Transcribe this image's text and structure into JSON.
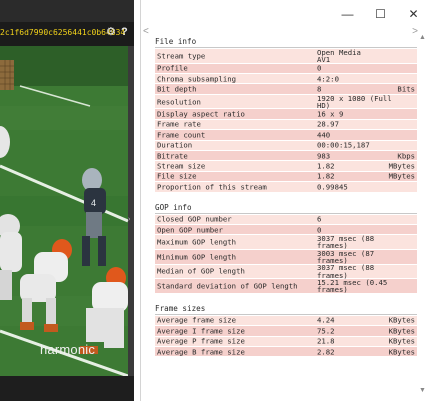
{
  "video_window": {
    "hash_text": "2c1f6d7990c6256441c0b64834",
    "gear_icon": "gear-icon",
    "help_label": "?",
    "watermark": "harmonic"
  },
  "info_window": {
    "controls": {
      "minimize": "—",
      "maximize": "☐",
      "close": "✕"
    },
    "nav": {
      "prev": "<",
      "next": ">"
    },
    "sections": [
      {
        "title": "File info",
        "rows": [
          {
            "label": "Stream type",
            "value": "Open Media\nAV1",
            "unit": ""
          },
          {
            "label": "Profile",
            "value": "0",
            "unit": ""
          },
          {
            "label": "Chroma subsampling",
            "value": "4:2:0",
            "unit": ""
          },
          {
            "label": "Bit depth",
            "value": "8",
            "unit": "Bits"
          },
          {
            "label": "Resolution",
            "value": "1920 x 1080 (Full\nHD)",
            "unit": ""
          },
          {
            "label": "Display aspect ratio",
            "value": "16 x 9",
            "unit": ""
          },
          {
            "label": "Frame rate",
            "value": "28.97",
            "unit": ""
          },
          {
            "label": "Frame count",
            "value": "440",
            "unit": ""
          },
          {
            "label": "Duration",
            "value": "00:00:15,187",
            "unit": ""
          },
          {
            "label": "Bitrate",
            "value": "983",
            "unit": "Kbps"
          },
          {
            "label": "Stream size",
            "value": "1.82",
            "unit": "MBytes"
          },
          {
            "label": "File size",
            "value": "1.82",
            "unit": "MBytes"
          },
          {
            "label": "Proportion of this stream",
            "value": "0.99845",
            "unit": ""
          }
        ]
      },
      {
        "title": "GOP info",
        "rows": [
          {
            "label": "Closed GOP number",
            "value": "6",
            "unit": ""
          },
          {
            "label": "Open GOP number",
            "value": "0",
            "unit": ""
          },
          {
            "label": "Maximum GOP length",
            "value": "3037 msec (88\nframes)",
            "unit": ""
          },
          {
            "label": "Minimum GOP length",
            "value": "3003 msec (87\nframes)",
            "unit": ""
          },
          {
            "label": "Median of GOP length",
            "value": "3037 msec (88\nframes)",
            "unit": ""
          },
          {
            "label": "Standard deviation of GOP length",
            "value": "15.21 msec (0.45\nframes)",
            "unit": ""
          }
        ]
      },
      {
        "title": "Frame sizes",
        "rows": [
          {
            "label": "Average frame size",
            "value": "4.24",
            "unit": "KBytes"
          },
          {
            "label": "Average I frame size",
            "value": "75.2",
            "unit": "KBytes"
          },
          {
            "label": "Average P frame size",
            "value": "21.8",
            "unit": "KBytes"
          },
          {
            "label": "Average B frame size",
            "value": "2.82",
            "unit": "KBytes"
          }
        ]
      }
    ]
  },
  "colors": {
    "row_light": "#fbe3de",
    "row_dark": "#f5d0cc",
    "hash_text": "#f2d21a",
    "field": "#2f6b2a"
  }
}
